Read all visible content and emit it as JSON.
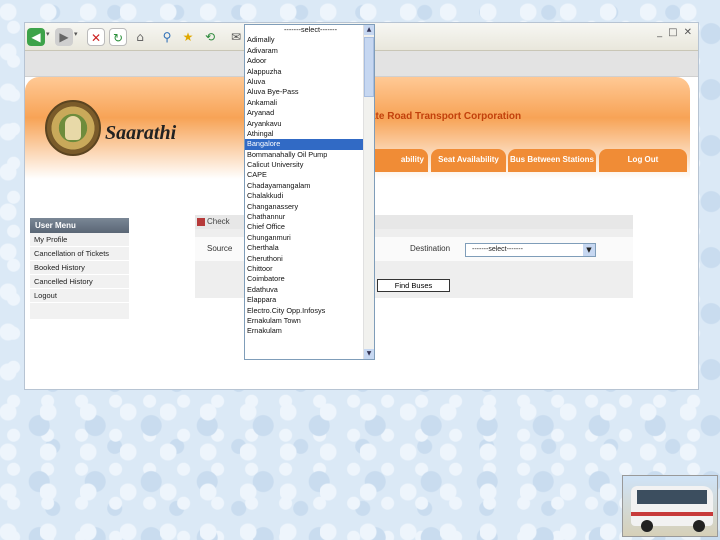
{
  "banner": {
    "brand": "Saarathi",
    "corporation": "ate Road Transport Corporation"
  },
  "nav": {
    "tabs": [
      {
        "label": "ability"
      },
      {
        "label": "Seat Availability"
      },
      {
        "label": "Bus Between Stations"
      },
      {
        "label": "Log Out"
      }
    ]
  },
  "user_menu": {
    "title": "User Menu",
    "items": [
      "My Profile",
      "Cancellation of Tickets",
      "Booked History",
      "Cancelled History",
      "Logout"
    ]
  },
  "panel": {
    "header": "Check",
    "source_label": "Source",
    "destination_label": "Destination",
    "destination_value": "-------select-------",
    "find_button": "Find Buses"
  },
  "dropdown": {
    "selected": "Bangalore",
    "options": [
      "-------select-------",
      "Adimally",
      "Adivaram",
      "Adoor",
      "Alappuzha",
      "Aluva",
      "Aluva Bye-Pass",
      "Ankamali",
      "Aryanad",
      "Aryankavu",
      "Athingal",
      "Bangalore",
      "Bommanahally Oil Pump",
      "Calicut University",
      "CAPE",
      "Chadayamangalam",
      "Chalakkudi",
      "Changanassery",
      "Chathannur",
      "Chief Office",
      "Chunganmuri",
      "Cherthala",
      "Cheruthoni",
      "Chittoor",
      "Coimbatore",
      "Edathuva",
      "Elappara",
      "Electro.City Opp.Infosys",
      "Ernakulam Town",
      "Ernakulam"
    ]
  }
}
